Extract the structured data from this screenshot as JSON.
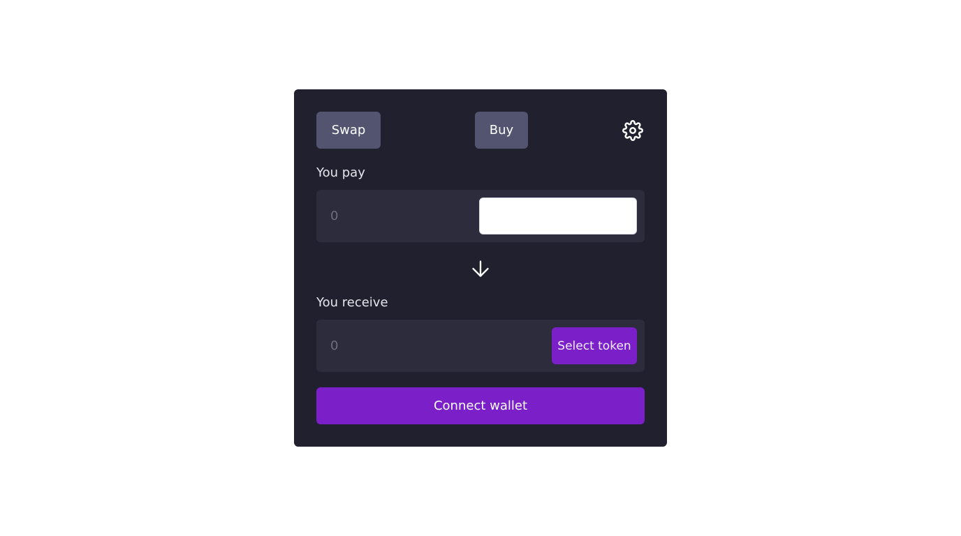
{
  "tabs": {
    "swap_label": "Swap",
    "buy_label": "Buy"
  },
  "pay": {
    "label": "You pay",
    "amount_placeholder": "0"
  },
  "receive": {
    "label": "You receive",
    "amount_placeholder": "0",
    "select_token_label": "Select token"
  },
  "actions": {
    "connect_label": "Connect wallet"
  },
  "icons": {
    "settings": "gear-icon",
    "switch": "arrow-down-icon"
  },
  "colors": {
    "card_bg": "#20202e",
    "field_bg": "#2d2c3c",
    "tab_bg": "#535570",
    "accent": "#7b1fc9"
  }
}
